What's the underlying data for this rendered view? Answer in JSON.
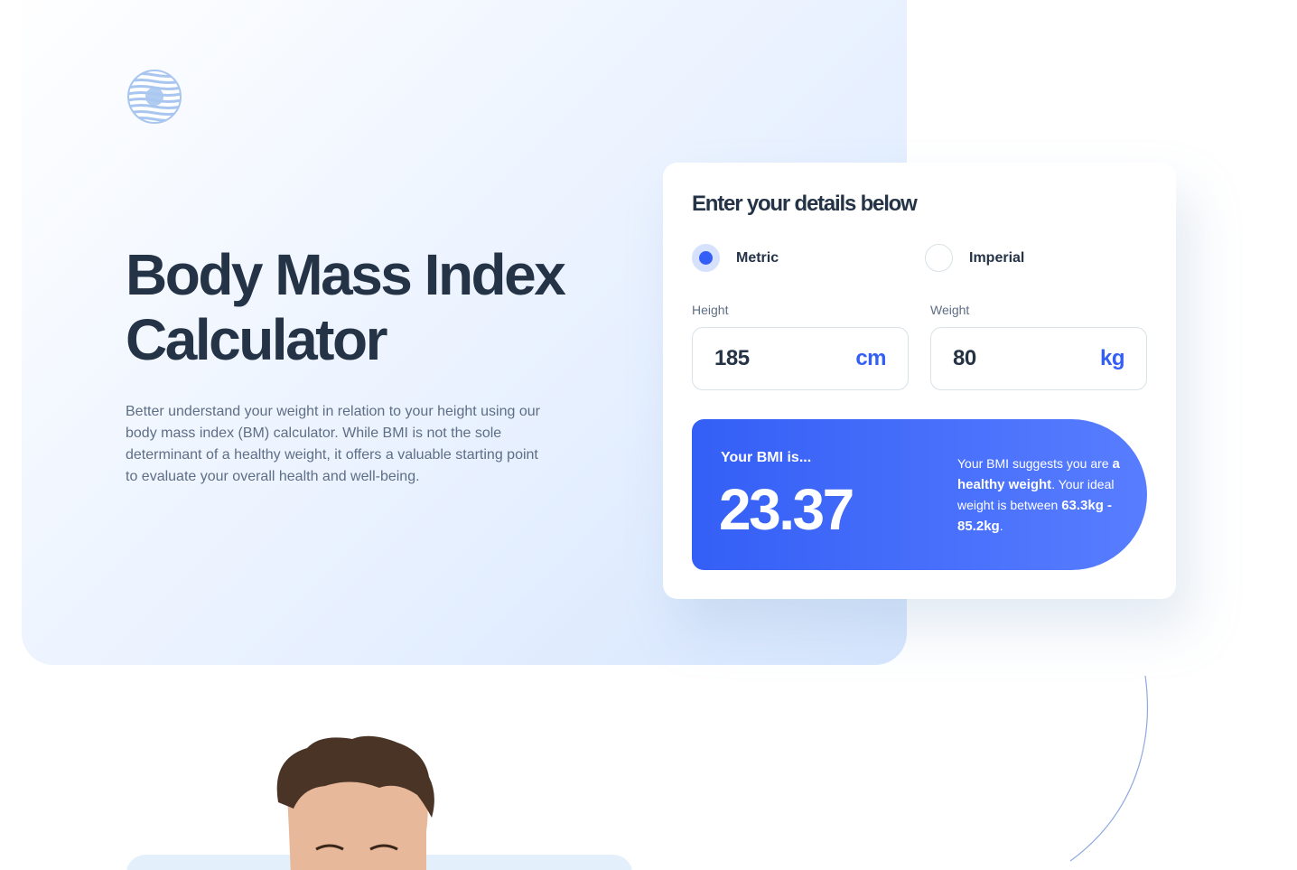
{
  "hero": {
    "logo_icon": "striped-circle-logo",
    "title": "Body Mass Index Calculator",
    "description": "Better understand your weight in relation to your height using our body mass index (BM) calculator. While BMI is not the sole determinant of a healthy weight, it offers a valuable starting point to evaluate your overall health and well-being."
  },
  "calculator": {
    "title": "Enter your details below",
    "units": {
      "metric_label": "Metric",
      "imperial_label": "Imperial",
      "selected": "Metric"
    },
    "height": {
      "label": "Height",
      "value": "185",
      "unit": "cm"
    },
    "weight": {
      "label": "Weight",
      "value": "80",
      "unit": "kg"
    },
    "result": {
      "label": "Your BMI is...",
      "value": "23.37",
      "text_prefix": "Your BMI suggests you are ",
      "classification": "a healthy weight",
      "text_middle": ". Your ideal weight is between ",
      "ideal_range": "63.3kg - 85.2kg",
      "text_suffix": "."
    }
  },
  "colors": {
    "primary": "#345ff6",
    "text_dark": "#253347",
    "text_muted": "#5e6e85",
    "border": "#d8e2e7"
  }
}
